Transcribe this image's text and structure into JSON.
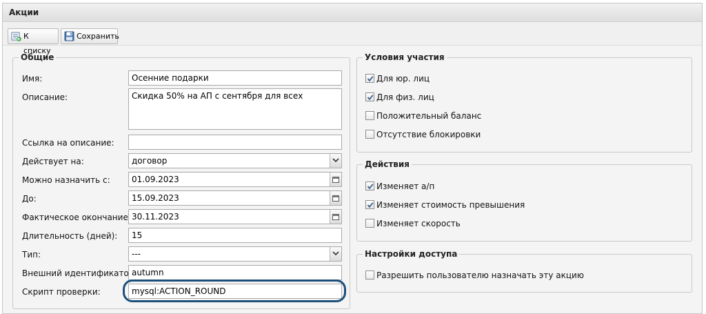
{
  "window": {
    "title": "Акции"
  },
  "toolbar": {
    "back": {
      "label": "К списку",
      "icon": "back-list-icon"
    },
    "save": {
      "label": "Сохранить",
      "icon": "floppy-save-icon"
    }
  },
  "general": {
    "legend": "Общие",
    "name": {
      "label": "Имя:",
      "value": "Осенние подарки"
    },
    "description": {
      "label": "Описание:",
      "value": "Скидка 50% на АП с сентября для всех"
    },
    "link": {
      "label": "Ссылка на описание:",
      "value": ""
    },
    "applies_to": {
      "label": "Действует на:",
      "value": "договор",
      "icon": "dropdown-arrow-icon"
    },
    "assign_from": {
      "label": "Можно назначить с:",
      "value": "01.09.2023",
      "icon": "calendar-icon"
    },
    "until": {
      "label": "До:",
      "value": "15.09.2023",
      "icon": "calendar-icon"
    },
    "actual_end": {
      "label": "Фактическое окончание:",
      "value": "30.11.2023",
      "icon": "calendar-icon"
    },
    "duration": {
      "label": "Длительность (дней):",
      "value": "15"
    },
    "type": {
      "label": "Тип:",
      "value": "---",
      "icon": "dropdown-arrow-icon"
    },
    "external_id": {
      "label": "Внешний идентификатор:",
      "value": "autumn"
    },
    "check_script": {
      "label": "Скрипт проверки:",
      "value": "mysql:ACTION_ROUND"
    }
  },
  "conditions": {
    "legend": "Условия участия",
    "items": [
      {
        "label": "Для юр. лиц",
        "checked": true
      },
      {
        "label": "Для физ. лиц",
        "checked": true
      },
      {
        "label": "Положительный баланс",
        "checked": false
      },
      {
        "label": "Отсутствие блокировки",
        "checked": false
      }
    ]
  },
  "actions": {
    "legend": "Действия",
    "items": [
      {
        "label": "Изменяет а/п",
        "checked": true
      },
      {
        "label": "Изменяет стоимость превышения",
        "checked": true
      },
      {
        "label": "Изменяет скорость",
        "checked": false
      }
    ]
  },
  "access": {
    "legend": "Настройки доступа",
    "items": [
      {
        "label": "Разрешить пользователю назначать эту акцию",
        "checked": false
      }
    ]
  },
  "colors": {
    "highlight": "#1b4f7a",
    "title_bg": "#e6e6e6",
    "panel_bg": "#f4f4f4"
  }
}
